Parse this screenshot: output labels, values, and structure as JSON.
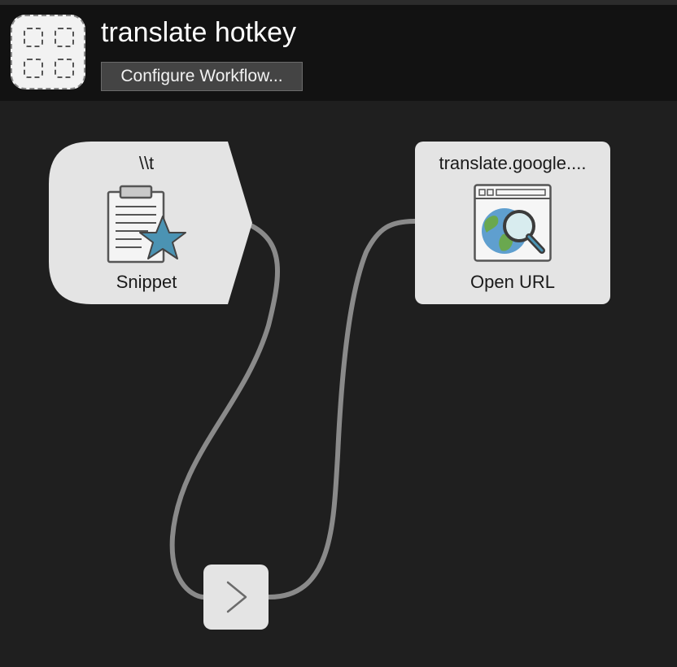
{
  "header": {
    "title": "translate hotkey",
    "configure_button": "Configure Workflow..."
  },
  "nodes": {
    "snippet": {
      "keyword": "\\\\t",
      "label": "Snippet",
      "icon": "clipboard-star-icon"
    },
    "open_url": {
      "title": "translate.google....",
      "label": "Open URL",
      "icon": "browser-globe-search-icon"
    },
    "connector": {
      "icon": "chevron-right-icon"
    }
  },
  "colors": {
    "canvas_bg": "#1f1f1f",
    "header_bg": "#121212",
    "node_bg": "#e4e4e4",
    "wire": "#8a8a8a",
    "star": "#4b93b3"
  }
}
